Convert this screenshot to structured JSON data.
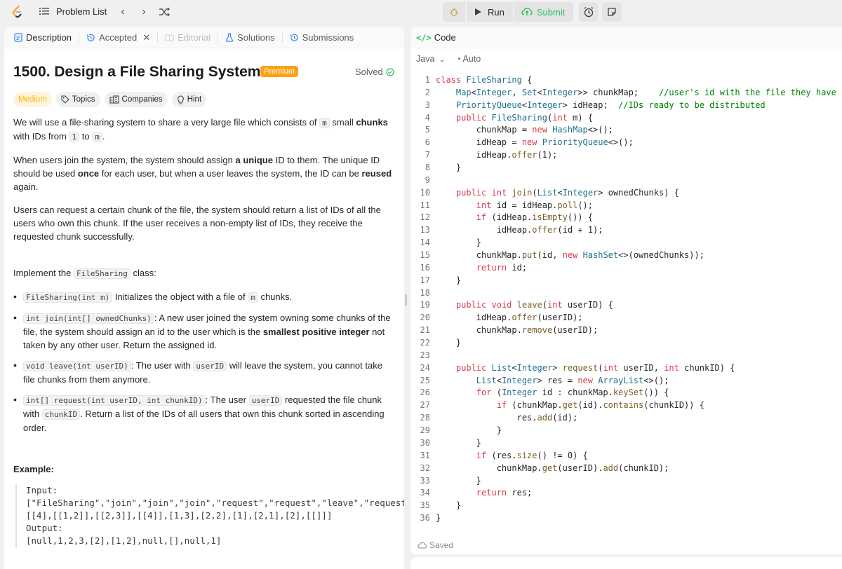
{
  "topbar": {
    "problem_list": "Problem List",
    "run": "Run",
    "submit": "Submit"
  },
  "left_tabs": [
    {
      "label": "Description"
    },
    {
      "label": "Accepted"
    },
    {
      "label": "Editorial"
    },
    {
      "label": "Solutions"
    },
    {
      "label": "Submissions"
    }
  ],
  "problem": {
    "title": "1500. Design a File Sharing System",
    "premium": "Premium",
    "status": "Solved",
    "difficulty": "Medium",
    "pills": [
      "Topics",
      "Companies",
      "Hint"
    ]
  },
  "description": {
    "p1_a": "We will use a file-sharing system to share a very large file which consists of",
    "p1_m": "m",
    "p1_b": "small",
    "p1_chunks": "chunks",
    "p1_c": "with IDs from",
    "p1_1": "1",
    "p1_to": "to",
    "p1_m2": "m",
    "p1_end": ".",
    "p2_a": "When users join the system, the system should assign",
    "p2_unique": "a unique",
    "p2_b": "ID to them. The unique ID should be used",
    "p2_once": "once",
    "p2_c": "for each user, but when a user leaves the system, the ID can be",
    "p2_reused": "reused",
    "p2_d": "again.",
    "p3": "Users can request a certain chunk of the file, the system should return a list of IDs of all the users who own this chunk. If the user receives a non-empty list of IDs, they receive the requested chunk successfully.",
    "impl_a": "Implement the",
    "impl_class": "FileSharing",
    "impl_b": "class:",
    "b1_code": "FileSharing(int m)",
    "b1_a": "Initializes the object with a file of",
    "b1_m": "m",
    "b1_b": "chunks.",
    "b2_code": "int join(int[] ownedChunks)",
    "b2_a": ": A new user joined the system owning some chunks of the file, the system should assign an id to the user which is the",
    "b2_bold": "smallest positive integer",
    "b2_b": "not taken by any other user. Return the assigned id.",
    "b3_code": "void leave(int userID)",
    "b3_a": ": The user with",
    "b3_uid": "userID",
    "b3_b": "will leave the system, you cannot take file chunks from them anymore.",
    "b4_code": "int[] request(int userID, int chunkID)",
    "b4_a": ": The user",
    "b4_uid": "userID",
    "b4_b": "requested the file chunk with",
    "b4_cid": "chunkID",
    "b4_c": ". Return a list of the IDs of all users that own this chunk sorted in ascending order.",
    "example_title": "Example:",
    "example_block": "Input:\n[\"FileSharing\",\"join\",\"join\",\"join\",\"request\",\"request\",\"leave\",\"request\",\"leave\",\"join\"]\n[[4],[[1,2]],[[2,3]],[[4]],[1,3],[2,2],[1],[2,1],[2],[[]]]\nOutput:\n[null,1,2,3,[2],[1,2],null,[],null,1]"
  },
  "code_panel": {
    "header": "Code",
    "language": "Java",
    "auto": "Auto",
    "saved": "Saved"
  },
  "code_lines": [
    "class FileSharing {",
    "    Map<Integer, Set<Integer>> chunkMap;    //user's id with the file they have",
    "    PriorityQueue<Integer> idHeap;  //IDs ready to be distributed",
    "    public FileSharing(int m) {",
    "        chunkMap = new HashMap<>();",
    "        idHeap = new PriorityQueue<>();",
    "        idHeap.offer(1);",
    "    }",
    "",
    "    public int join(List<Integer> ownedChunks) {",
    "        int id = idHeap.poll();",
    "        if (idHeap.isEmpty()) {",
    "            idHeap.offer(id + 1);",
    "        }",
    "        chunkMap.put(id, new HashSet<>(ownedChunks));",
    "        return id;",
    "    }",
    "",
    "    public void leave(int userID) {",
    "        idHeap.offer(userID);",
    "        chunkMap.remove(userID);",
    "    }",
    "",
    "    public List<Integer> request(int userID, int chunkID) {",
    "        List<Integer> res = new ArrayList<>();",
    "        for (Integer id : chunkMap.keySet()) {",
    "            if (chunkMap.get(id).contains(chunkID)) {",
    "                res.add(id);",
    "            }",
    "        }",
    "        if (res.size() != 0) {",
    "            chunkMap.get(userID).add(chunkID);",
    "        }",
    "        return res;",
    "    }",
    "}"
  ],
  "colors": {
    "accent": "#ffa116",
    "submit_green": "#2cbb5d",
    "keyword": "#d73a49",
    "type": "#1f6f8b",
    "comment": "#008000"
  }
}
